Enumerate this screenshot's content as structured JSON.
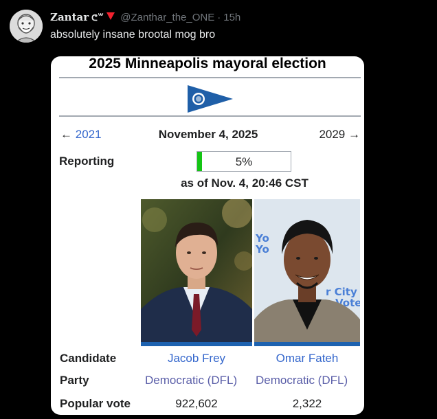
{
  "tweet": {
    "display_name": "Zantar",
    "name_glyph": "ᕦ꒳",
    "handle": "@Zanthar_the_ONE",
    "separator": "·",
    "time": "15h",
    "text": "absolutely insane brootal mog bro"
  },
  "infobox": {
    "title": "2025 Minneapolis mayoral election",
    "prev_year": "2021",
    "prev_arrow": "←",
    "date": "November 4, 2025",
    "next_year": "2029",
    "next_arrow": "→",
    "reporting_label": "Reporting",
    "reporting_value": "5%",
    "reporting_fraction": 0.05,
    "as_of": "as of Nov. 4, 20:46 CST",
    "row_labels": {
      "candidate": "Candidate",
      "party": "Party",
      "popular_vote": "Popular vote"
    },
    "candidates": [
      {
        "name": "Jacob Frey",
        "party": "Democratic (DFL)",
        "votes": "922,602"
      },
      {
        "name": "Omar Fateh",
        "party": "Democratic (DFL)",
        "votes": "2,322"
      }
    ],
    "party_color": "#1d62b0",
    "progress_color": "#14c514"
  }
}
